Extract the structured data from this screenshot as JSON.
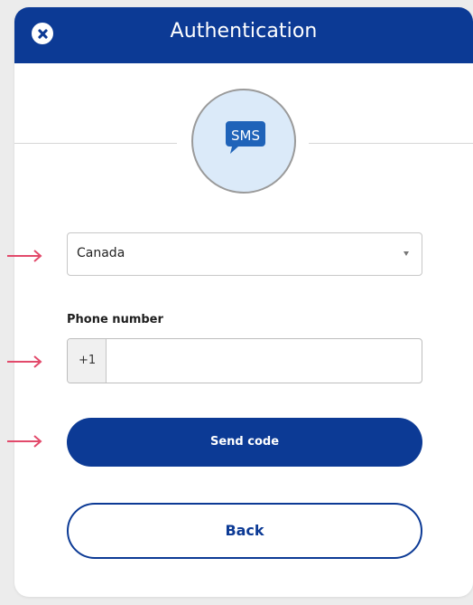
{
  "header": {
    "title": "Authentication",
    "close_icon": "close-icon"
  },
  "sms_badge": {
    "label": "SMS",
    "icon": "speech-bubble-icon"
  },
  "country_select": {
    "selected": "Canada",
    "caret_icon": "chevron-down-icon"
  },
  "phone": {
    "label": "Phone number",
    "prefix": "+1",
    "value": "",
    "placeholder": ""
  },
  "buttons": {
    "send_label": "Send code",
    "back_label": "Back"
  },
  "annotations": {
    "arrow_icon": "arrow-right-icon",
    "arrow_color": "#e24a6b"
  },
  "colors": {
    "brand": "#0c3a95",
    "bubble": "#1f63b9",
    "badge_fill": "#dbeaf9"
  }
}
